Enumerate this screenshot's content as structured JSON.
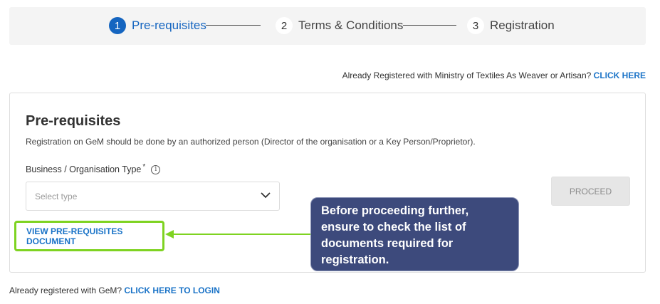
{
  "stepper": {
    "steps": [
      {
        "number": "1",
        "label": "Pre-requisites",
        "state": "active"
      },
      {
        "number": "2",
        "label": "Terms & Conditions",
        "state": "inactive"
      },
      {
        "number": "3",
        "label": "Registration",
        "state": "inactive"
      }
    ]
  },
  "ministry": {
    "text": "Already Registered with Ministry of Textiles As Weaver or Artisan?",
    "link": "CLICK HERE"
  },
  "card": {
    "title": "Pre-requisites",
    "description": "Registration on GeM should be done by an authorized person (Director of the organisation or a Key Person/Proprietor).",
    "field_label": "Business / Organisation Type",
    "required_mark": "*",
    "info_icon": "i",
    "select_placeholder": "Select type",
    "proceed_label": "PROCEED",
    "view_doc_label": "VIEW PRE-REQUISITES DOCUMENT"
  },
  "tooltip": {
    "text": "Before proceeding further, ensure to check the list of documents required for registration."
  },
  "login": {
    "text": "Already registered with GeM?",
    "link": "CLICK HERE TO LOGIN"
  },
  "colors": {
    "accent": "#1565c0",
    "link": "#1a73c7",
    "highlight": "#7ed321",
    "tooltip_bg": "#3d4a7c"
  }
}
